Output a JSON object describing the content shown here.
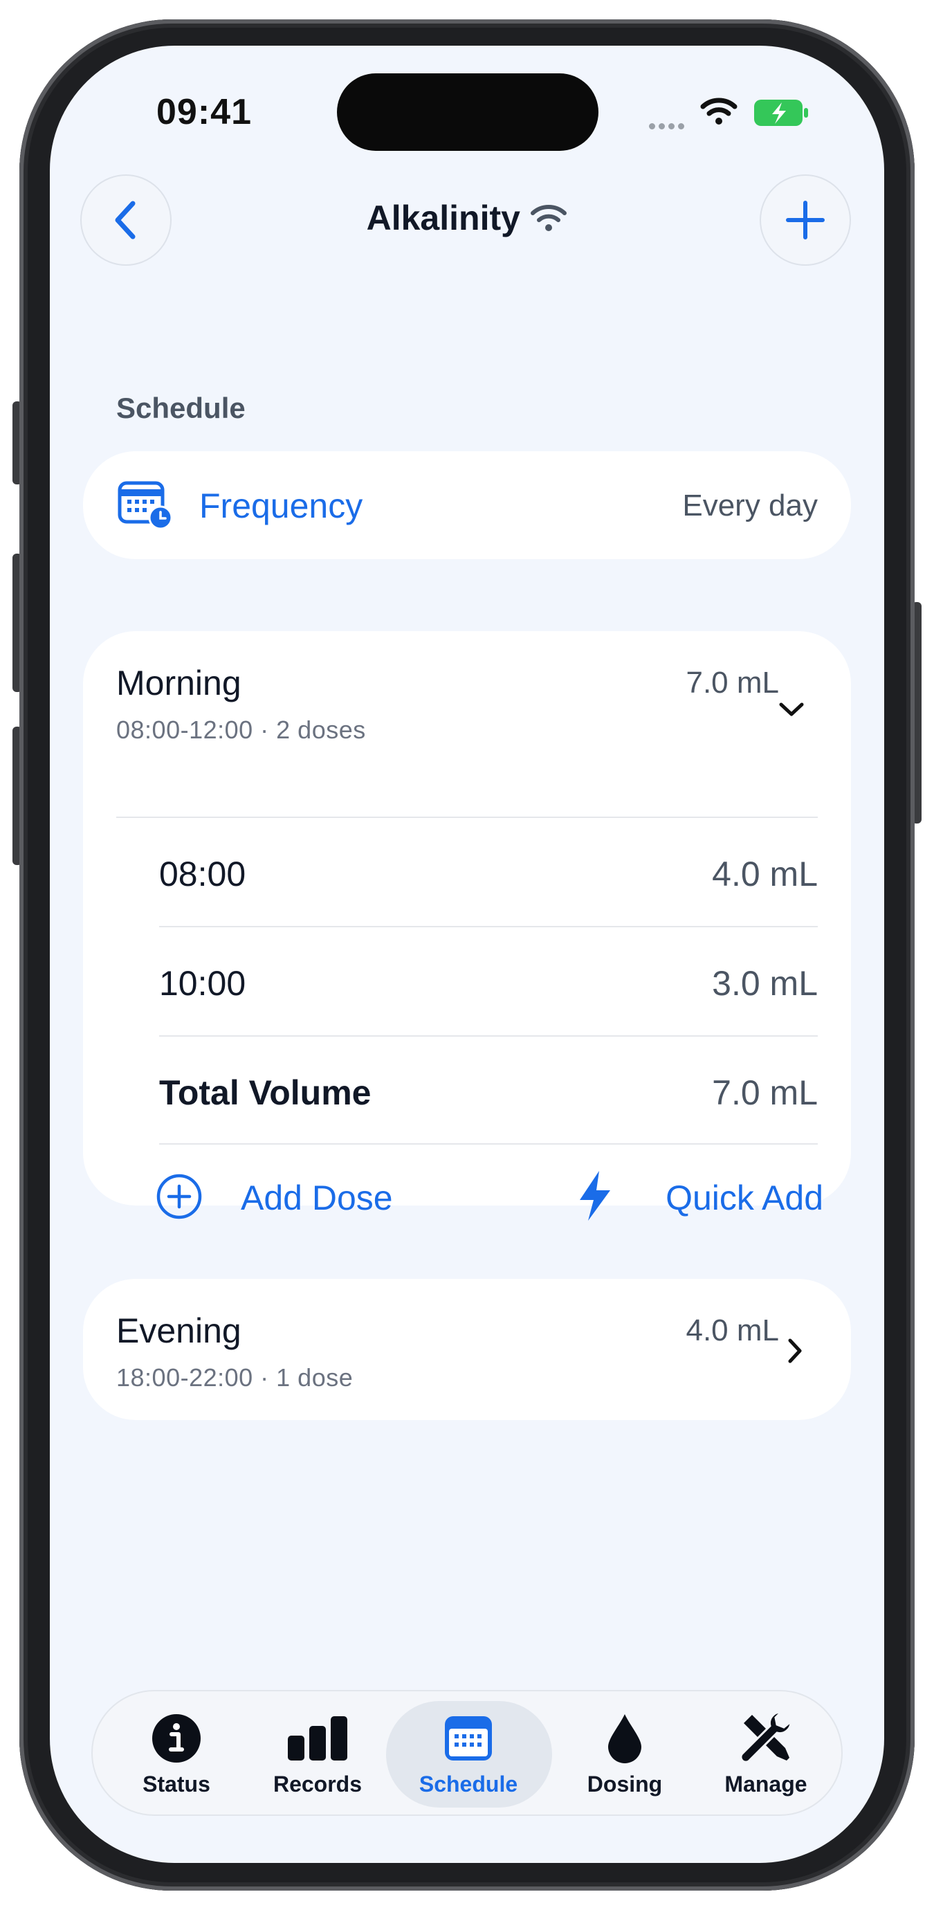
{
  "status_bar": {
    "time": "09:41"
  },
  "nav": {
    "title": "Alkalinity"
  },
  "schedule": {
    "section_label": "Schedule",
    "frequency": {
      "label": "Frequency",
      "value": "Every day"
    }
  },
  "morning": {
    "name": "Morning",
    "subtitle": "08:00-12:00 · 2 doses",
    "total": "7.0 mL",
    "doses": [
      {
        "time": "08:00",
        "volume": "4.0 mL"
      },
      {
        "time": "10:00",
        "volume": "3.0 mL"
      }
    ],
    "total_label": "Total Volume",
    "total_value": "7.0 mL",
    "add_dose_label": "Add Dose",
    "quick_add_label": "Quick Add"
  },
  "evening": {
    "name": "Evening",
    "subtitle": "18:00-22:00 · 1 dose",
    "total": "4.0 mL"
  },
  "tabs": [
    {
      "label": "Status",
      "icon": "info-icon"
    },
    {
      "label": "Records",
      "icon": "bar-chart-icon"
    },
    {
      "label": "Schedule",
      "icon": "calendar-icon",
      "active": true
    },
    {
      "label": "Dosing",
      "icon": "drop-icon"
    },
    {
      "label": "Manage",
      "icon": "tools-icon"
    }
  ],
  "colors": {
    "accent": "#1a6ce8",
    "background": "#f2f6fd",
    "battery": "#34c759"
  }
}
